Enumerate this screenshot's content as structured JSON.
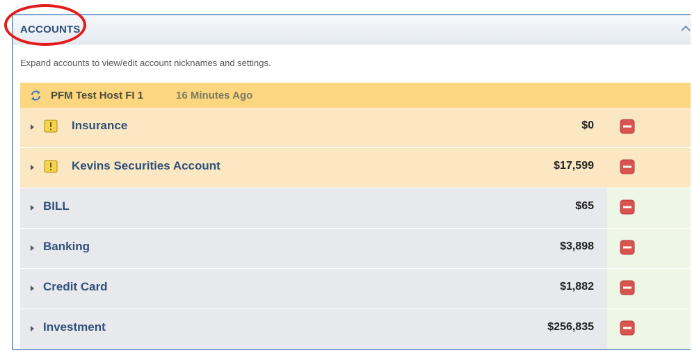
{
  "panel": {
    "title": "ACCOUNTS",
    "hint": "Expand accounts to view/edit account nicknames and settings."
  },
  "institution": {
    "name": "PFM Test Host FI 1",
    "last_updated": "16 Minutes Ago"
  },
  "accounts": [
    {
      "label": "Insurance",
      "amount": "$0",
      "warning": true
    },
    {
      "label": "Kevins Securities Account",
      "amount": "$17,599",
      "warning": true
    },
    {
      "label": "BILL",
      "amount": "$65",
      "warning": false
    },
    {
      "label": "Banking",
      "amount": "$3,898",
      "warning": false
    },
    {
      "label": "Credit Card",
      "amount": "$1,882",
      "warning": false
    },
    {
      "label": "Investment",
      "amount": "$256,835",
      "warning": false
    }
  ],
  "icons": {
    "sync": "sync-icon",
    "warning": "warning-icon",
    "delete": "minus-delete-icon",
    "collapse": "chevron-up-icon",
    "expand": "triangle-right-icon"
  },
  "colors": {
    "title": "#2c4d75",
    "institution_bar": "#fcd780",
    "warning_row": "#fbe8c3",
    "normal_row": "#e8e9ec",
    "delete": "#d9534f",
    "annotation_ring": "#e21b1b"
  }
}
